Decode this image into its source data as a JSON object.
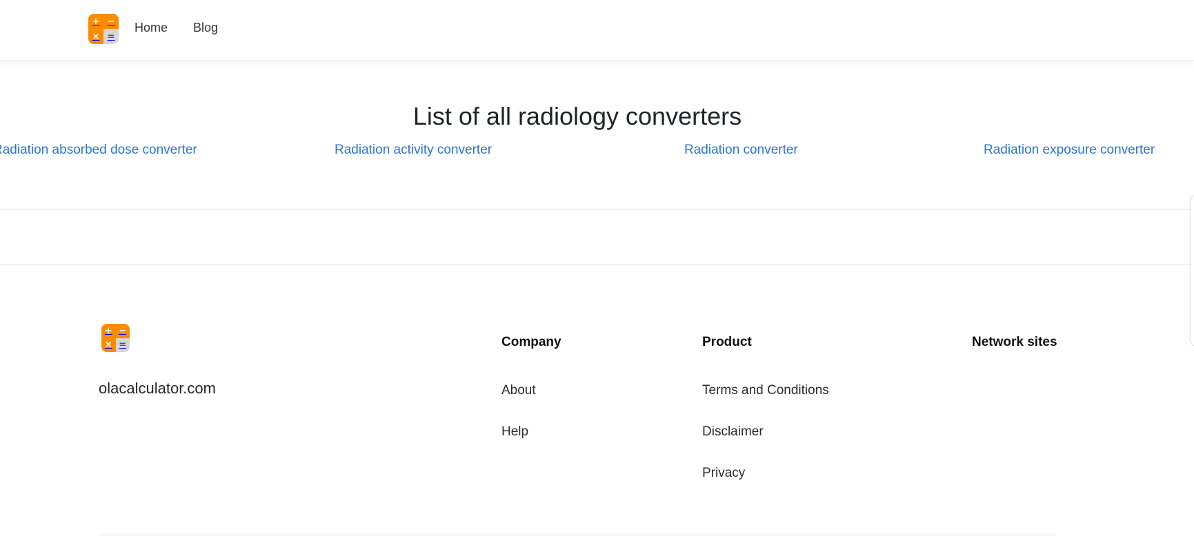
{
  "header": {
    "logo_icon": "calculator-icon",
    "logo_symbols": [
      "+",
      "−",
      "×",
      "="
    ],
    "nav": [
      {
        "label": "Home"
      },
      {
        "label": "Blog"
      }
    ]
  },
  "main": {
    "title": "List of all radiology converters",
    "converters": [
      {
        "label": "Radiation absorbed dose converter"
      },
      {
        "label": "Radiation activity converter"
      },
      {
        "label": "Radiation converter"
      },
      {
        "label": "Radiation exposure converter"
      }
    ]
  },
  "footer": {
    "logo_icon": "calculator-icon",
    "site_name": "olacalculator.com",
    "company": {
      "heading": "Company",
      "links": [
        {
          "label": "About"
        },
        {
          "label": "Help"
        }
      ]
    },
    "product": {
      "heading": "Product",
      "links": [
        {
          "label": "Terms and Conditions"
        },
        {
          "label": "Disclaimer"
        },
        {
          "label": "Privacy"
        }
      ]
    },
    "network": {
      "heading": "Network sites"
    }
  },
  "colors": {
    "accent_orange": "#fb8c00",
    "link_blue": "#2a74d9",
    "text_dark": "#212529"
  }
}
